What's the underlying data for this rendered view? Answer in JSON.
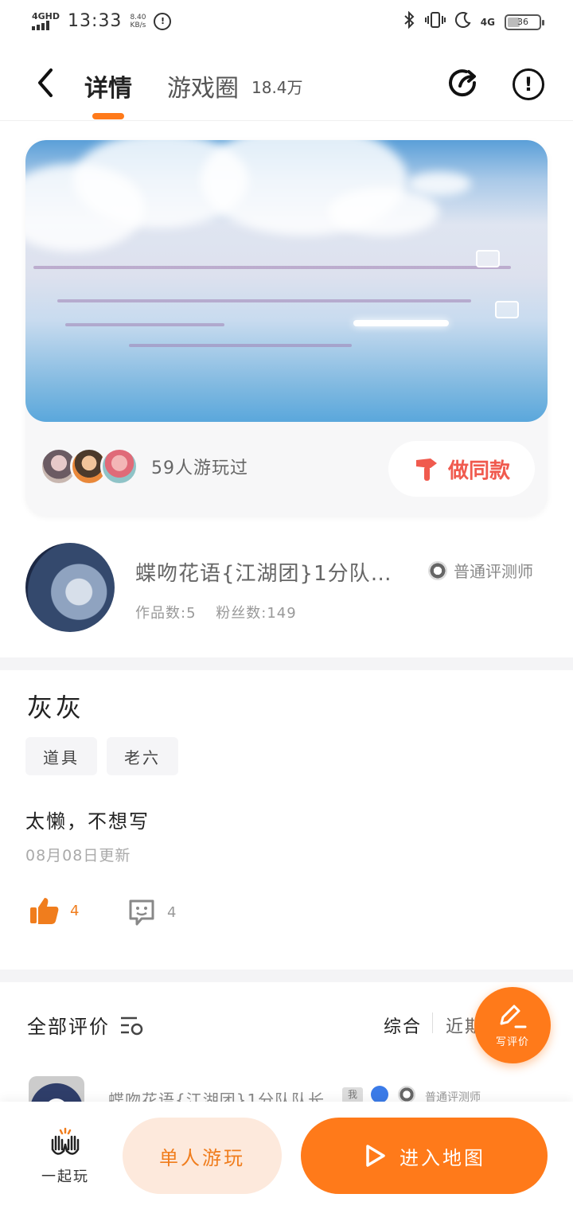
{
  "status_bar": {
    "network": "4GHD",
    "time": "13:33",
    "speed_value": "8.40",
    "speed_unit": "KB/s",
    "right_network": "4G",
    "battery": "36",
    "battery_level": 0.36
  },
  "header": {
    "tab_detail": "详情",
    "tab_circle": "游戏圈",
    "circle_count": "18.4万"
  },
  "card": {
    "played_text": "59人游玩过",
    "make_same_label": "做同款"
  },
  "author": {
    "name": "蝶吻花语{江湖团}1分队…",
    "badge_text": "普通评测师",
    "works": "作品数:5",
    "fans": "粉丝数:149"
  },
  "detail": {
    "title": "灰灰",
    "tags": [
      "道具",
      "老六"
    ],
    "description": "太懒，不想写",
    "updated": "08月08日更新",
    "likes": "4",
    "comments": "4"
  },
  "reviews": {
    "title": "全部评价",
    "sort_options": [
      "综合",
      "近期"
    ],
    "fab_label": "写评价",
    "peek_name": "蝶吻花语{江湖团}1分队队长",
    "peek_me": "我",
    "peek_level": "普通评测师"
  },
  "bottom": {
    "together_label": "一起玩",
    "solo_label": "单人游玩",
    "enter_label": "进入地图"
  },
  "colors": {
    "accent": "#ff7a1a",
    "make_same": "#f05a4e"
  }
}
